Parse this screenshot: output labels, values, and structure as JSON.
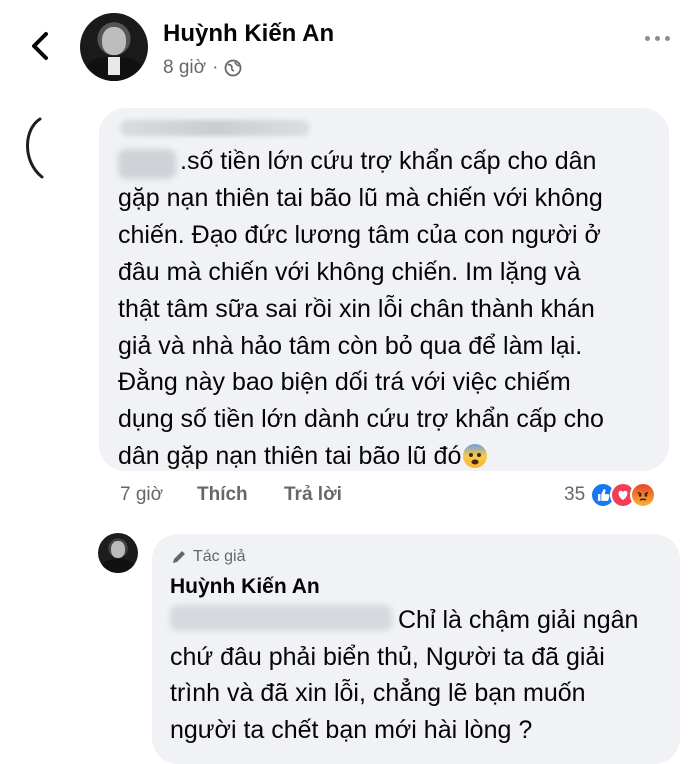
{
  "post": {
    "author": "Huỳnh Kiến An",
    "time": "8 giờ",
    "separator": "·"
  },
  "comment": {
    "author_hidden": "Nguyễn Quốc Bảo",
    "lines": [
      ".số tiền lớn cứu trợ khẩn cấp cho dân",
      "gặp nạn thiên tai bão lũ mà chiến với không",
      "chiến. Đạo đức lương tâm của con người ở",
      "đâu mà chiến với không chiến. Im lặng và",
      "thật tâm sữa sai rồi xin lỗi chân thành khán",
      "giả và nhà hảo tâm còn bỏ qua để làm lại.",
      "Đằng này bao biện dối trá với việc chiếm",
      "dụng số tiền lớn dành cứu trợ khẩn cấp cho",
      "dân gặp nạn thiên tai bão lũ đó"
    ],
    "time": "7 giờ",
    "like_label": "Thích",
    "reply_label": "Trả lời",
    "reaction_count": "35",
    "reactions": [
      "like-reaction-icon",
      "love-reaction-icon",
      "angry-reaction-icon"
    ]
  },
  "reply": {
    "badge": "Tác giả",
    "author": "Huỳnh Kiến An",
    "lines": [
      "Chỉ là chậm giải ngân",
      "chứ đâu phải biển thủ, Người ta đã giải",
      "trình và đã xin lỗi, chẳng lẽ bạn muốn",
      "người ta chết bạn mới hài lòng ?"
    ]
  },
  "colors": {
    "bubble": "#f0f2f5",
    "meta": "#65676b",
    "like_blue": "#1877f2",
    "love_red": "#f33e58",
    "angry_orange": "#f7714b"
  }
}
